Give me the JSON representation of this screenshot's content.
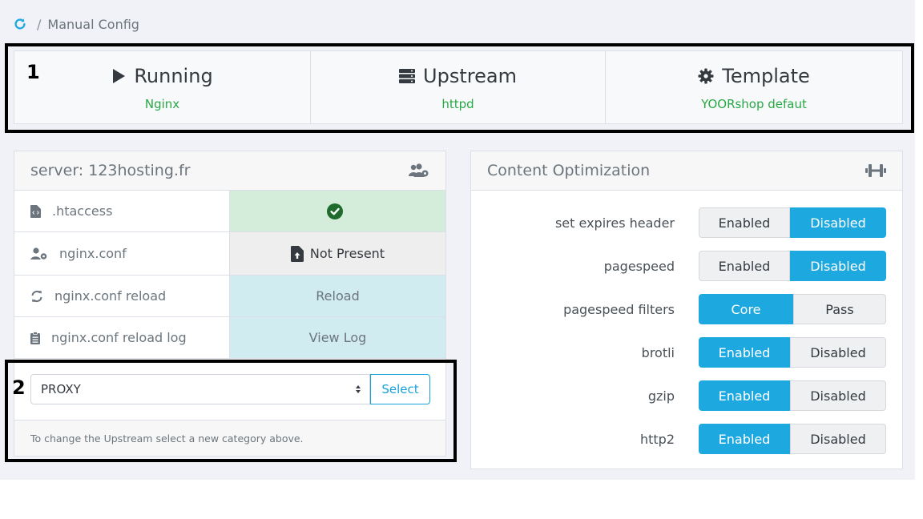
{
  "breadcrumb": {
    "separator": "/",
    "current": "Manual Config"
  },
  "stats": [
    {
      "title": "Running",
      "value": "Nginx",
      "icon": "play-icon"
    },
    {
      "title": "Upstream",
      "value": "httpd",
      "icon": "server-icon"
    },
    {
      "title": "Template",
      "value": "YOORshop defaut",
      "icon": "gear-icon"
    }
  ],
  "annotations": {
    "one": "1",
    "two": "2"
  },
  "server": {
    "title": "server: 123hosting.fr",
    "rows": [
      {
        "label": ".htaccess",
        "value": ""
      },
      {
        "label": "nginx.conf",
        "value": "Not Present"
      },
      {
        "label": "nginx.conf reload",
        "value": "Reload"
      },
      {
        "label": "nginx.conf reload log",
        "value": "View Log"
      }
    ],
    "select_value": "PROXY",
    "select_button": "Select",
    "help": "To change the Upstream select a new category above."
  },
  "optimization": {
    "title": "Content Optimization",
    "rows": [
      {
        "label": "set expires header",
        "options": [
          "Enabled",
          "Disabled"
        ],
        "active": 1
      },
      {
        "label": "pagespeed",
        "options": [
          "Enabled",
          "Disabled"
        ],
        "active": 1
      },
      {
        "label": "pagespeed filters",
        "options": [
          "Core",
          "Pass"
        ],
        "active": 0
      },
      {
        "label": "brotli",
        "options": [
          "Enabled",
          "Disabled"
        ],
        "active": 0
      },
      {
        "label": "gzip",
        "options": [
          "Enabled",
          "Disabled"
        ],
        "active": 0
      },
      {
        "label": "http2",
        "options": [
          "Enabled",
          "Disabled"
        ],
        "active": 0
      }
    ]
  },
  "colors": {
    "accent": "#1ea8e0",
    "success": "#28a745",
    "annotation": "#000000"
  }
}
